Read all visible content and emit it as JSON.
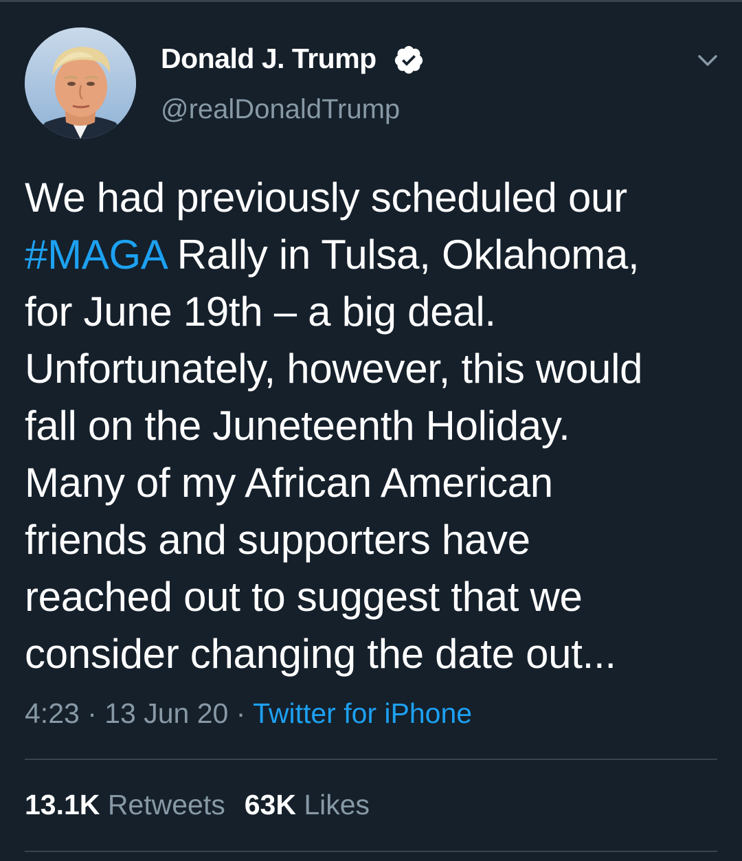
{
  "user": {
    "display_name": "Donald J. Trump",
    "handle": "@realDonaldTrump",
    "verified": true,
    "avatar_icon": "profile-photo"
  },
  "tweet": {
    "line1": "We had previously scheduled our",
    "line2_hashtag": "#MAGA",
    "line2_rest": " Rally in Tulsa, Oklahoma,",
    "line3": "for June 19th – a big deal.",
    "line4": "Unfortunately, however, this would",
    "line5": "fall on the Juneteenth Holiday.",
    "line6": "Many of my African American",
    "line7": "friends and supporters have",
    "line8": "reached out to suggest that we",
    "line9": "consider changing the date out..."
  },
  "meta": {
    "time": "4:23",
    "separator": " · ",
    "date": "13 Jun 20",
    "source": "Twitter for iPhone"
  },
  "stats": {
    "retweets_count": "13.1K",
    "retweets_label": " Retweets",
    "likes_count": "63K",
    "likes_label": " Likes"
  },
  "colors": {
    "background": "#15202b",
    "accent": "#1da1f2",
    "secondary_text": "#8899a6",
    "divider": "#38444d"
  }
}
